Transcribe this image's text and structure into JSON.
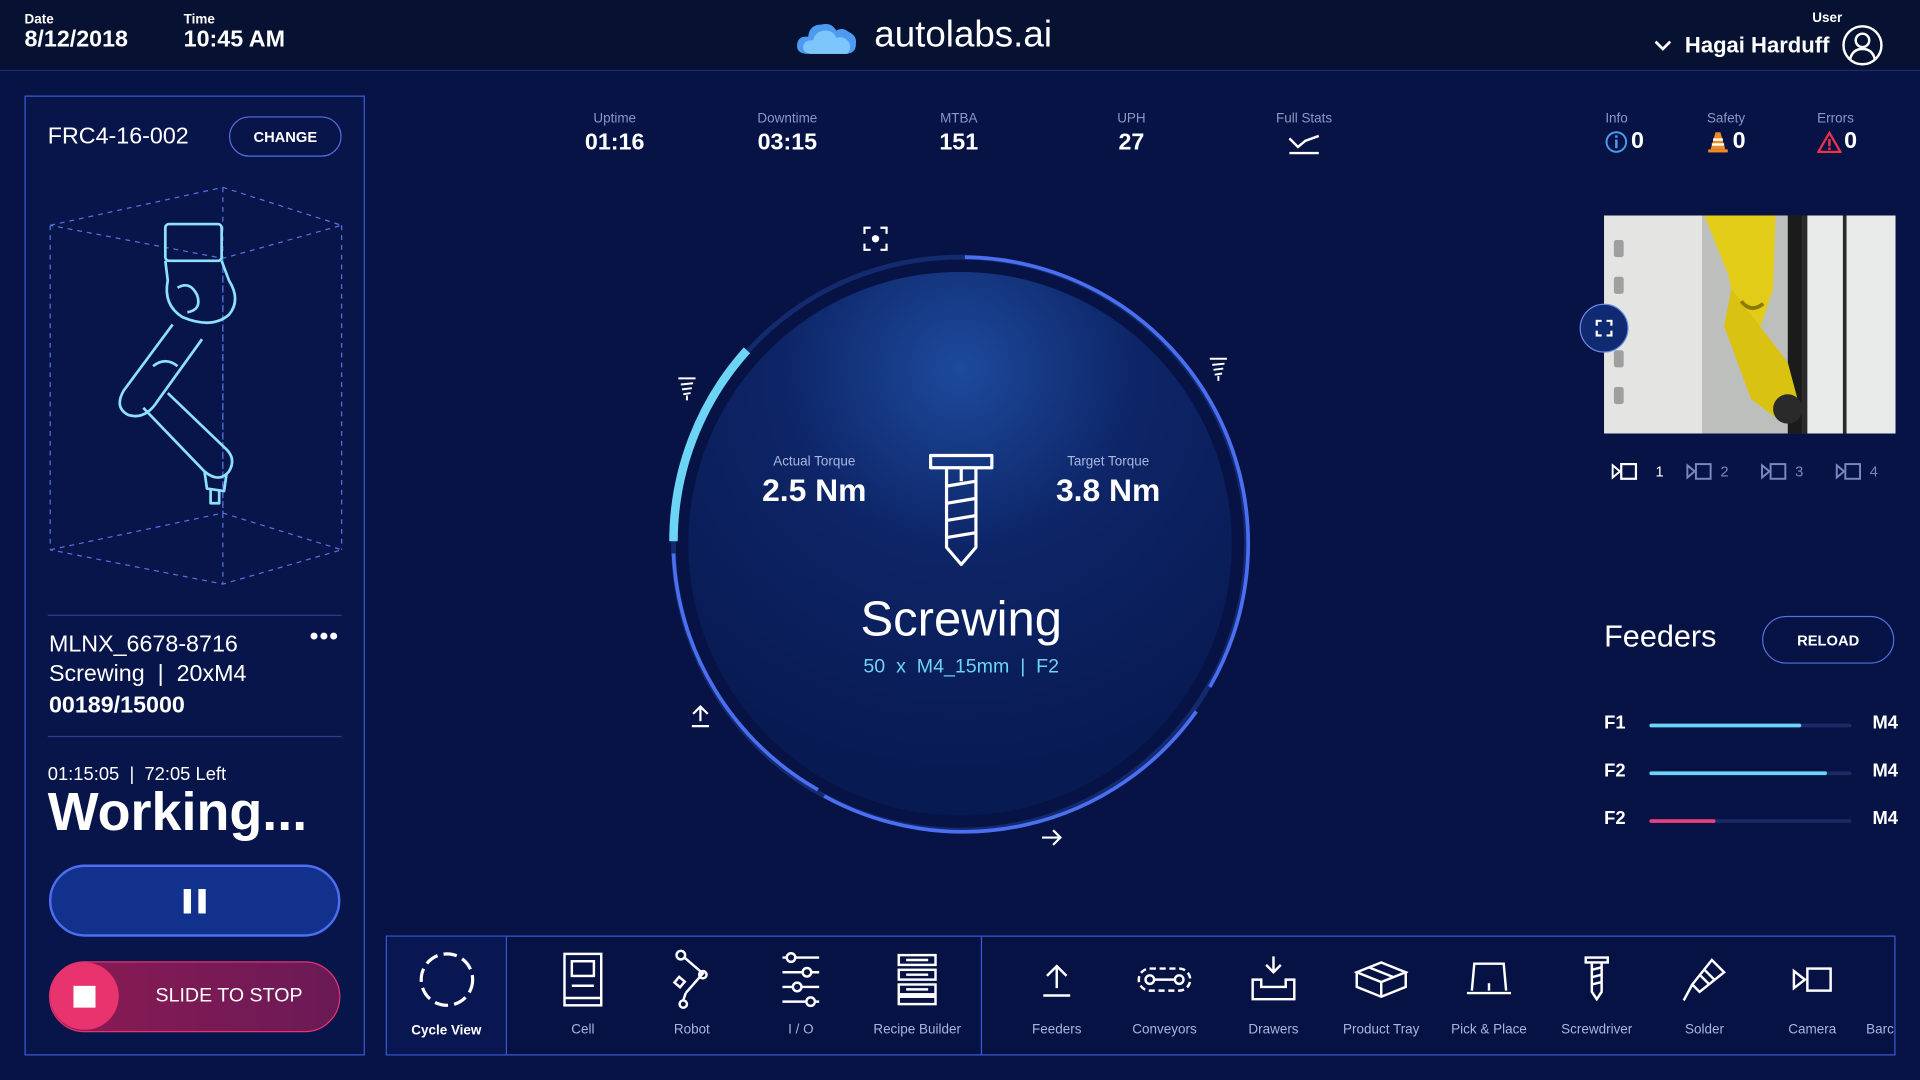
{
  "header": {
    "date_label": "Date",
    "date": "8/12/2018",
    "time_label": "Time",
    "time": "10:45 AM",
    "brand": "autolabs.ai",
    "user_label": "User",
    "user": "Hagai Harduff"
  },
  "cell_panel": {
    "cell_id": "FRC4-16-002",
    "change_label": "CHANGE",
    "job_id": "MLNX_6678-8716",
    "job_desc": "Screwing  |  20xM4",
    "count": "00189/15000",
    "timer": "01:15:05  |  72:05 Left",
    "status": "Working...",
    "stop_label": "SLIDE TO STOP"
  },
  "stats": [
    {
      "label": "Uptime",
      "value": "01:16"
    },
    {
      "label": "Downtime",
      "value": "03:15"
    },
    {
      "label": "MTBA",
      "value": "151"
    },
    {
      "label": "UPH",
      "value": "27"
    }
  ],
  "full_stats_label": "Full Stats",
  "alerts": [
    {
      "label": "Info",
      "value": "0"
    },
    {
      "label": "Safety",
      "value": "0"
    },
    {
      "label": "Errors",
      "value": "0"
    }
  ],
  "gauge": {
    "actual_label": "Actual Torque",
    "actual_value": "2.5 Nm",
    "target_label": "Target Torque",
    "target_value": "3.8 Nm",
    "operation": "Screwing",
    "detail": "50  x  M4_15mm  |  F2",
    "progress": 0.1
  },
  "cameras": [
    "1",
    "2",
    "3",
    "4"
  ],
  "feeders": {
    "title": "Feeders",
    "reload_label": "RELOAD",
    "items": [
      {
        "name": "F1",
        "type": "M4",
        "level": 0.75,
        "color": "#6cd4f5"
      },
      {
        "name": "F2",
        "type": "M4",
        "level": 0.88,
        "color": "#6cd4f5"
      },
      {
        "name": "F2",
        "type": "M4",
        "level": 0.33,
        "color": "#ee3f7f"
      }
    ]
  },
  "dock": {
    "tools": [
      {
        "label": "Cycle View",
        "icon": "cycle-view-icon"
      },
      {
        "label": "Cell",
        "icon": "cell-icon"
      },
      {
        "label": "Robot",
        "icon": "robot-icon"
      },
      {
        "label": "I / O",
        "icon": "io-icon"
      },
      {
        "label": "Recipe Builder",
        "icon": "recipe-builder-icon"
      },
      {
        "label": "Feeders",
        "icon": "feeders-icon"
      },
      {
        "label": "Conveyors",
        "icon": "conveyors-icon"
      },
      {
        "label": "Drawers",
        "icon": "drawers-icon"
      },
      {
        "label": "Product Tray",
        "icon": "product-tray-icon"
      },
      {
        "label": "Pick & Place",
        "icon": "pick-place-icon"
      },
      {
        "label": "Screwdriver",
        "icon": "screwdriver-icon"
      },
      {
        "label": "Solder",
        "icon": "solder-icon"
      },
      {
        "label": "Camera",
        "icon": "camera-icon"
      },
      {
        "label": "Barc",
        "icon": "barcode-icon"
      }
    ]
  },
  "colors": {
    "accent": "#6cd4f5",
    "ring": "#4a6ff0",
    "stop": "#e8336e",
    "bg": "#061344"
  }
}
